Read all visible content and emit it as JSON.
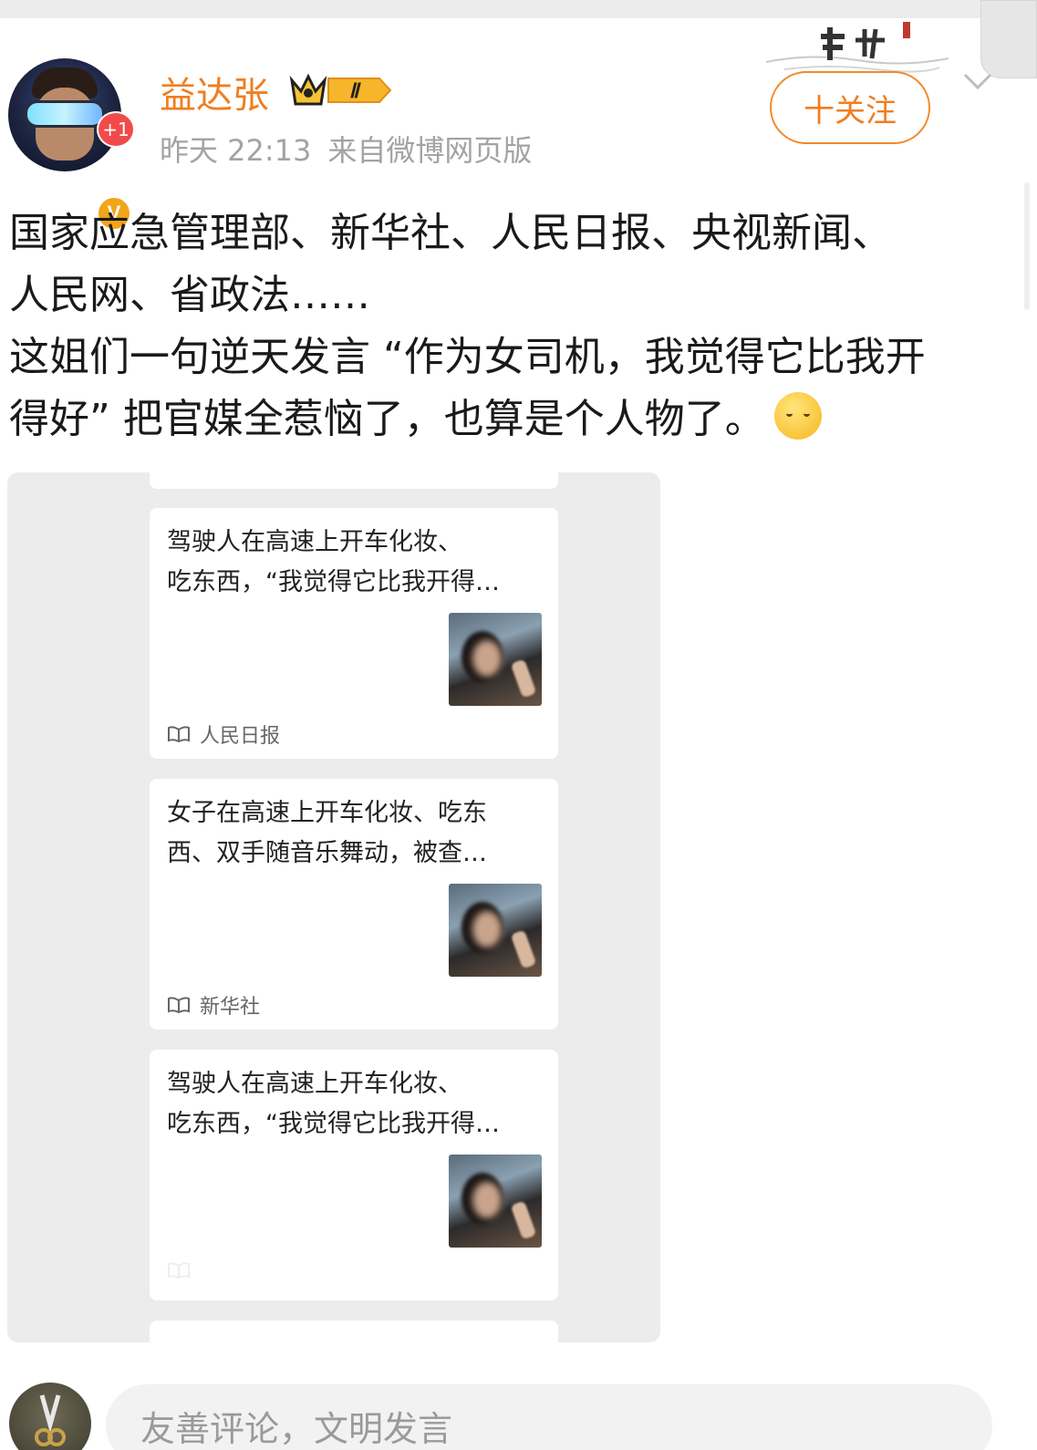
{
  "post": {
    "author": {
      "name": "益达张",
      "notification_count": "+1",
      "verified_badge": "V",
      "level_badge": "Ⅱ"
    },
    "time": "昨天 22:13",
    "source": "来自微博网页版",
    "follow_label": "十关注",
    "text_line1": "国家应急管理部、新华社、人民日报、央视新闻、",
    "text_line2": "人民网、省政法……",
    "text_line3": "这姐们一句逆天发言 “作为女司机，我觉得它比我开",
    "text_line4": "得好” 把官媒全惹恼了，也算是个人物了。",
    "emoji_icon": "shy-smile-emoji"
  },
  "embedded_screenshot": {
    "cards": [
      {
        "line1": "驾驶人在高速上开车化妆、",
        "line2": "吃东西，“我觉得它比我开得…",
        "source": "人民日报"
      },
      {
        "line1": "女子在高速上开车化妆、吃东",
        "line2": "西、双手随音乐舞动，被查…",
        "source": "新华社"
      },
      {
        "line1": "驾驶人在高速上开车化妆、",
        "line2": "吃东西，“我觉得它比我开得…",
        "source": ""
      }
    ]
  },
  "comment": {
    "placeholder": "友善评论，文明发言"
  },
  "colors": {
    "accent_orange": "#f07e1f",
    "meta_gray": "#a3a3a3",
    "badge_red": "#f24a4a",
    "badge_gold": "#f2a51a"
  }
}
